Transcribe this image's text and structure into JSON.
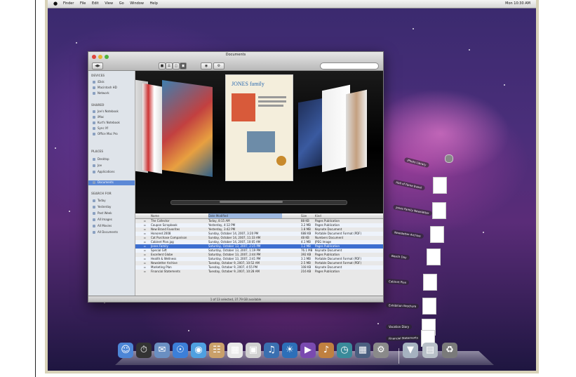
{
  "menubar": {
    "apple": "",
    "menus": [
      "Finder",
      "File",
      "Edit",
      "View",
      "Go",
      "Window",
      "Help"
    ],
    "clock": "Mon 10:30 AM"
  },
  "finder": {
    "title": "Documents",
    "sidebar": {
      "sections": [
        {
          "heading": "DEVICES",
          "items": [
            "iDisk",
            "Macintosh HD",
            "Network"
          ]
        },
        {
          "heading": "SHARED",
          "items": [
            "Joe's Notebook",
            "iMac",
            "Kurt's Notebook",
            "Sync Xf",
            "Office Mac Pro"
          ]
        },
        {
          "heading": "PLACES",
          "items": [
            "Desktop",
            "Joe",
            "Applications",
            "Documents"
          ]
        },
        {
          "heading": "SEARCH FOR",
          "items": [
            "Today",
            "Yesterday",
            "Past Week",
            "All Images",
            "All Movies",
            "All Documents"
          ]
        }
      ],
      "selected": "Documents"
    },
    "columns": [
      "Name",
      "Date Modified",
      "Size",
      "Kind"
    ],
    "rows": [
      {
        "name": "The Collector",
        "date": "Today, 8:15 AM",
        "size": "88 KB",
        "kind": "Pages Publication"
      },
      {
        "name": "Coupon Scrapbook",
        "date": "Yesterday, 4:12 PM",
        "size": "3.2 MB",
        "kind": "Pages Publication"
      },
      {
        "name": "New Brand Favorites",
        "date": "Yesterday, 3:42 PM",
        "size": "1.8 MB",
        "kind": "Keynote Document"
      },
      {
        "name": "Honored 2008",
        "date": "Sunday, October 14, 2007, 3:20 PM",
        "size": "688 KB",
        "kind": "Portable Document Format (PDF)"
      },
      {
        "name": "Cat Purchase Comparison",
        "date": "Sunday, October 14, 2007, 11:33 AM",
        "size": "48 KB",
        "kind": "Numbers Document"
      },
      {
        "name": "Cabinet Plan.jpg",
        "date": "Sunday, October 14, 2007, 10:05 AM",
        "size": "4.1 MB",
        "kind": "JPEG Image"
      },
      {
        "name": "Jones Family",
        "date": "Saturday, October 13, 2007, 2:25 PM",
        "size": "1.2 MB",
        "kind": "Pages Publication"
      },
      {
        "name": "Special Gift",
        "date": "Saturday, October 13, 2007, 1:19 PM",
        "size": "76.1 MB",
        "kind": "Keynote Document"
      },
      {
        "name": "Excellent Globe",
        "date": "Saturday, October 13, 2007, 2:44 PM",
        "size": "392 KB",
        "kind": "Pages Publication"
      },
      {
        "name": "Health & Wellness",
        "date": "Saturday, October 13, 2007, 2:41 PM",
        "size": "3.1 MB",
        "kind": "Portable Document Format (PDF)"
      },
      {
        "name": "Newsletter Archive",
        "date": "Tuesday, October 9, 2007, 10:52 AM",
        "size": "2.5 MB",
        "kind": "Portable Document Format (PDF)"
      },
      {
        "name": "Marketing Plan",
        "date": "Tuesday, October 9, 2007, 4:55 PM",
        "size": "108 KB",
        "kind": "Keynote Document"
      },
      {
        "name": "Financial Statements",
        "date": "Tuesday, October 9, 2007, 10:28 AM",
        "size": "216 KB",
        "kind": "Pages Publication"
      }
    ],
    "selected_row": 6,
    "status": "1 of 13 selected, 37.79 GB available",
    "cover_flow": {
      "title": "JONES family"
    }
  },
  "stack": {
    "items": [
      "iPhoto Library",
      "Hall of Fame Event",
      "Jones Family Newsletter",
      "Newsletter Archive",
      "Beach Day",
      "Cabinet Plan",
      "Exhibition Brochure",
      "Vacation Diary",
      "Financial Statements"
    ]
  },
  "dock": {
    "icons": [
      "finder-icon",
      "dashboard-icon",
      "mail-icon",
      "safari-icon",
      "ichat-icon",
      "address-book-icon",
      "ical-icon",
      "preview-icon",
      "itunes-icon",
      "iphoto-icon",
      "imovie-icon",
      "garageband-icon",
      "time-machine-icon",
      "spaces-icon",
      "system-preferences-icon",
      "downloads-stack-icon",
      "documents-stack-icon",
      "trash-icon"
    ]
  }
}
